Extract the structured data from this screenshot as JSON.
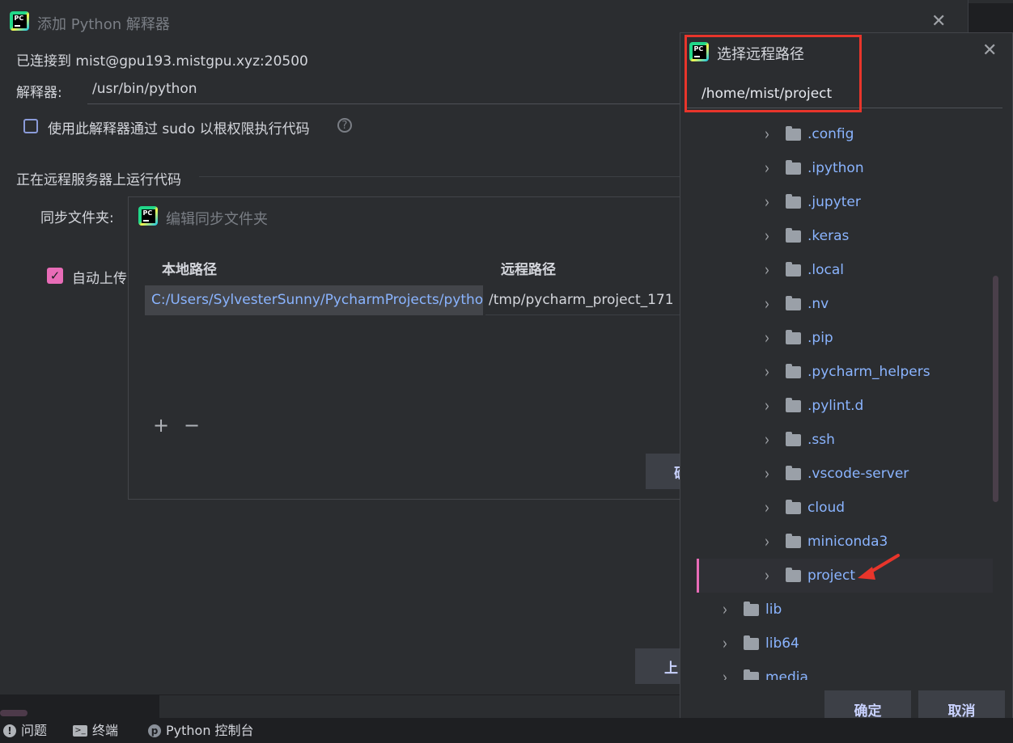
{
  "main_dialog": {
    "title": "添加 Python 解释器",
    "connected_text": "已连接到 mist@gpu193.mistgpu.xyz:20500",
    "interpreter_label": "解释器:",
    "interpreter_value": "/usr/bin/python",
    "sudo_checkbox_label": "使用此解释器通过 sudo 以根权限执行代码",
    "sudo_checked": false,
    "section_title": "正在远程服务器上运行代码",
    "sync_folder_label": "同步文件夹:",
    "auto_upload_label": "自动上传",
    "auto_upload_checked": true,
    "bottom_button_partial": "上"
  },
  "sync_dialog": {
    "title": "编辑同步文件夹",
    "columns": [
      "本地路径",
      "远程路径"
    ],
    "rows": [
      {
        "local": "C:/Users/SylvesterSunny/PycharmProjects/pytho...",
        "remote": "/tmp/pycharm_project_171"
      }
    ],
    "add_label": "+",
    "remove_label": "−",
    "ok_partial": "确"
  },
  "chooser": {
    "title": "选择远程路径",
    "path_value": "/home/mist/project",
    "tree_items": [
      {
        "label": ".config",
        "level": 2
      },
      {
        "label": ".ipython",
        "level": 2
      },
      {
        "label": ".jupyter",
        "level": 2
      },
      {
        "label": ".keras",
        "level": 2
      },
      {
        "label": ".local",
        "level": 2
      },
      {
        "label": ".nv",
        "level": 2
      },
      {
        "label": ".pip",
        "level": 2
      },
      {
        "label": ".pycharm_helpers",
        "level": 2
      },
      {
        "label": ".pylint.d",
        "level": 2
      },
      {
        "label": ".ssh",
        "level": 2
      },
      {
        "label": ".vscode-server",
        "level": 2
      },
      {
        "label": "cloud",
        "level": 2
      },
      {
        "label": "miniconda3",
        "level": 2
      },
      {
        "label": "project",
        "level": 2,
        "selected": true
      },
      {
        "label": "lib",
        "level": 1
      },
      {
        "label": "lib64",
        "level": 1
      },
      {
        "label": "media",
        "level": 1
      }
    ],
    "ok_label": "确定",
    "cancel_label": "取消"
  },
  "statusbar": {
    "problems": "问题",
    "terminal": "终端",
    "python_console": "Python 控制台"
  },
  "colors": {
    "accent_pink": "#e86cb7",
    "link_blue": "#8ab4ff",
    "annotation_red": "#e8352b"
  }
}
